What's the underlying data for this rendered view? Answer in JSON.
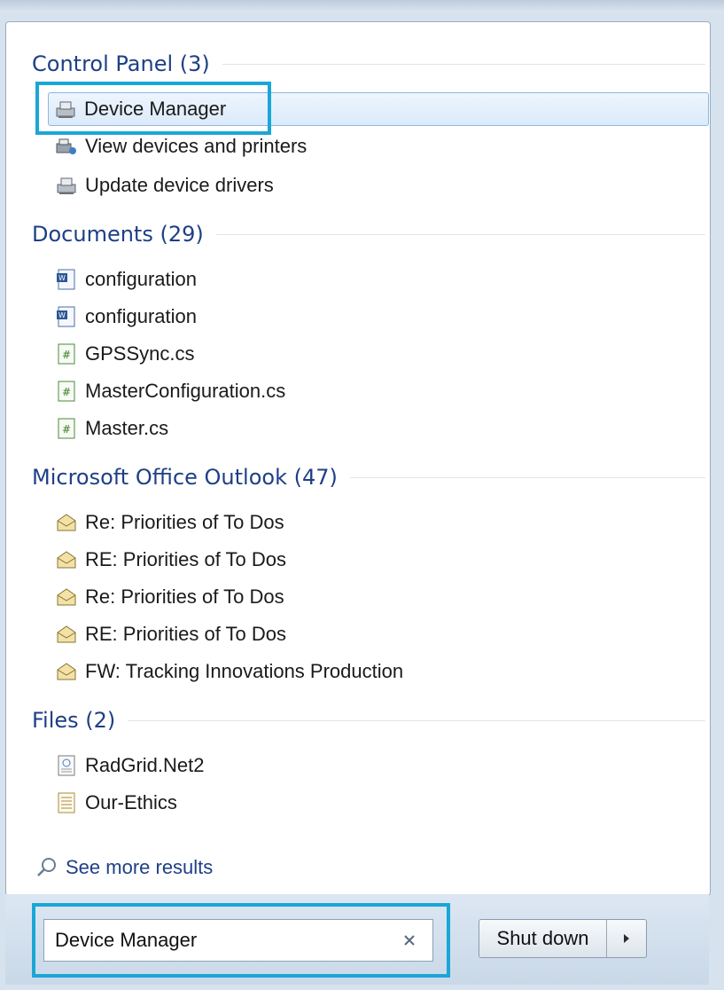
{
  "sections": [
    {
      "title": "Control Panel (3)",
      "items": [
        {
          "label": "Device Manager",
          "icon": "device-manager-icon",
          "selected": true
        },
        {
          "label": "View devices and printers",
          "icon": "devices-printers-icon"
        },
        {
          "label": "Update device drivers",
          "icon": "device-manager-icon"
        }
      ]
    },
    {
      "title": "Documents (29)",
      "items": [
        {
          "label": "configuration",
          "icon": "word-document-icon"
        },
        {
          "label": "configuration",
          "icon": "word-document-icon"
        },
        {
          "label": "GPSSync.cs",
          "icon": "csharp-file-icon"
        },
        {
          "label": "MasterConfiguration.cs",
          "icon": "csharp-file-icon"
        },
        {
          "label": "Master.cs",
          "icon": "csharp-file-icon"
        }
      ]
    },
    {
      "title": "Microsoft Office Outlook (47)",
      "items": [
        {
          "label": "Re: Priorities of To Dos",
          "icon": "mail-open-icon"
        },
        {
          "label": "RE: Priorities of To Dos",
          "icon": "mail-open-icon"
        },
        {
          "label": "Re: Priorities of To Dos",
          "icon": "mail-open-icon"
        },
        {
          "label": "RE: Priorities of To Dos",
          "icon": "mail-open-icon"
        },
        {
          "label": "FW: Tracking Innovations Production",
          "icon": "mail-open-icon"
        }
      ]
    },
    {
      "title": "Files (2)",
      "items": [
        {
          "label": "RadGrid.Net2",
          "icon": "web-file-icon"
        },
        {
          "label": "Our-Ethics",
          "icon": "text-file-icon"
        }
      ]
    }
  ],
  "see_more": {
    "label": "See more results",
    "icon": "magnifier-icon"
  },
  "search": {
    "value": "Device Manager",
    "clear_icon": "clear-x-icon"
  },
  "shutdown": {
    "label": "Shut down",
    "arrow_icon": "chevron-right-icon"
  },
  "colors": {
    "section_title": "#1e3f87",
    "highlight": "#1aa6d6",
    "selection": "#dbeafb"
  }
}
